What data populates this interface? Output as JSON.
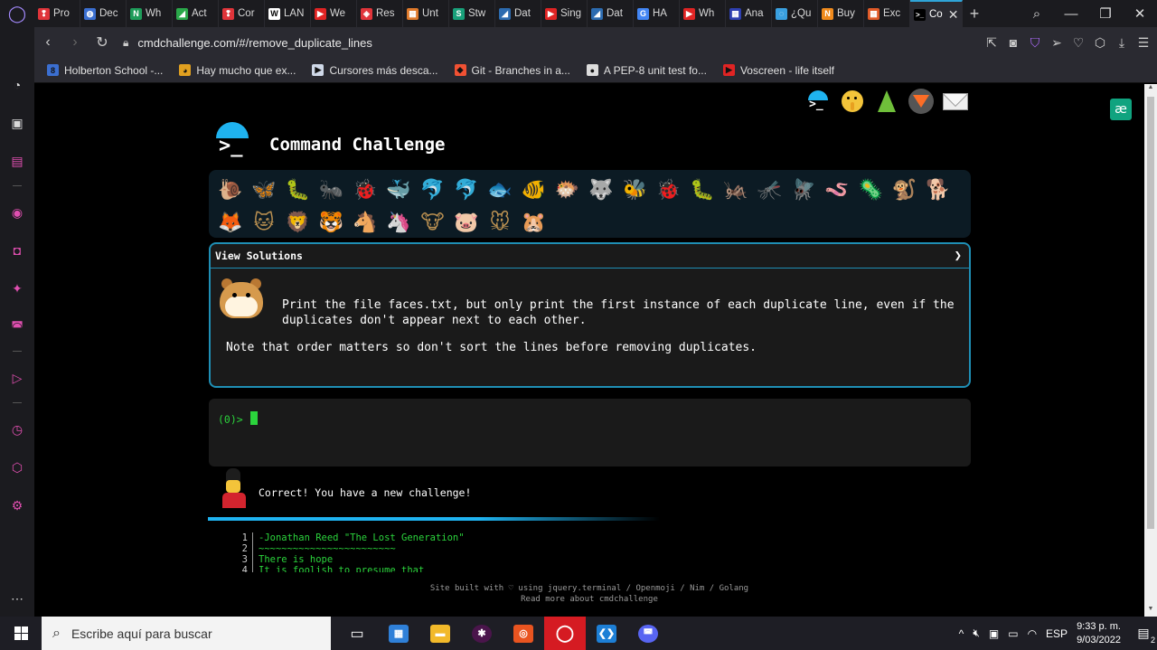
{
  "browser": {
    "tabs": [
      {
        "label": "Pro",
        "color": "#e0343a",
        "glyph": "❢"
      },
      {
        "label": "Dec",
        "color": "#3b6fd1",
        "glyph": "◍"
      },
      {
        "label": "Wh",
        "color": "#1e9c5a",
        "glyph": "N"
      },
      {
        "label": "Act",
        "color": "#2aa84a",
        "glyph": "◢"
      },
      {
        "label": "Cor",
        "color": "#e0343a",
        "glyph": "❢"
      },
      {
        "label": "LAN",
        "color": "#ffffff",
        "glyph": "W"
      },
      {
        "label": "We",
        "color": "#e02424",
        "glyph": "▶"
      },
      {
        "label": "Res",
        "color": "#e0343a",
        "glyph": "◈"
      },
      {
        "label": "Unt",
        "color": "#e07a2b",
        "glyph": "▦"
      },
      {
        "label": "Stw",
        "color": "#18a07a",
        "glyph": "S"
      },
      {
        "label": "Dat",
        "color": "#2c6bb0",
        "glyph": "◢"
      },
      {
        "label": "Sing",
        "color": "#e02424",
        "glyph": "▶"
      },
      {
        "label": "Dat",
        "color": "#2c6bb0",
        "glyph": "◢"
      },
      {
        "label": "HA",
        "color": "#4285f4",
        "glyph": "G"
      },
      {
        "label": "Wh",
        "color": "#e02424",
        "glyph": "▶"
      },
      {
        "label": "Ana",
        "color": "#2e3fb0",
        "glyph": "▦"
      },
      {
        "label": "¿Qu",
        "color": "#3aa0e0",
        "glyph": "◌"
      },
      {
        "label": "Buy",
        "color": "#f08a1c",
        "glyph": "N"
      },
      {
        "label": "Exc",
        "color": "#e05a28",
        "glyph": "▦"
      }
    ],
    "active_tab": {
      "label": "Co",
      "glyph": ">_"
    },
    "url": "cmdchallenge.com/#/remove_duplicate_lines",
    "bookmarks": [
      {
        "label": "Holberton School -...",
        "color": "#3b6fd1",
        "glyph": "8"
      },
      {
        "label": "Hay mucho que ex...",
        "color": "#e0a020",
        "glyph": "◕"
      },
      {
        "label": "Cursores más desca...",
        "color": "#cfd8e8",
        "glyph": "▶"
      },
      {
        "label": "Git - Branches in a...",
        "color": "#f05133",
        "glyph": "◆"
      },
      {
        "label": "A PEP-8 unit test fo...",
        "color": "#dddddd",
        "glyph": "●"
      },
      {
        "label": "Voscreen - life itself",
        "color": "#e02424",
        "glyph": "▶"
      }
    ]
  },
  "page": {
    "site_title": "Command Challenge",
    "logo_prompt": ">_",
    "top_icons": [
      "terminal-icon",
      "shushing-face-icon",
      "evergreen-tree-icon",
      "gitlab-icon",
      "envelope-icon"
    ],
    "ae_badge": "æ",
    "animals_row1": [
      "🐌",
      "🦋",
      "🐛",
      "🐜",
      "🐞",
      "🐳",
      "🐬",
      "🐬",
      "🐟",
      "🐠",
      "🐡",
      "🐺",
      "🐝",
      "🐞",
      "🐛",
      "🦗",
      "🦟",
      "🪰",
      "🪱",
      "🦠",
      "🐒",
      "🐕"
    ],
    "animals_row2": [
      "🦊",
      "🐱",
      "🦁",
      "🐯",
      "🐴",
      "🦄",
      "🐮",
      "🐷",
      "🐭",
      "🐹"
    ],
    "view_solutions": "View Solutions",
    "challenge_text": "Print the file faces.txt, but only print the first instance of each duplicate line, even if the duplicates don't appear next to each other.",
    "challenge_note": "Note that order matters so don't sort the lines before removing duplicates.",
    "terminal_prompt": "(0)>",
    "correct_message": "Correct! You have a new challenge!",
    "file_lines": [
      {
        "n": "1",
        "text": "-Jonathan Reed \"The Lost Generation\""
      },
      {
        "n": "2",
        "text": "~~~~~~~~~~~~~~~~~~~~~~~~"
      },
      {
        "n": "3",
        "text": "There is hope"
      },
      {
        "n": "4",
        "text": "It is foolish to presume that"
      }
    ],
    "footer_line1": "Site built with ♡ using jquery.terminal / Openmoji / Nim / Golang",
    "footer_line2": "Read more about cmdchallenge"
  },
  "taskbar": {
    "search_placeholder": "Escribe aquí para buscar",
    "language": "ESP",
    "time": "9:33 p. m.",
    "date": "9/03/2022",
    "notifications": "2"
  },
  "colors": {
    "accent": "#1fb3f0",
    "terminal_green": "#2bd43c",
    "challenge_border": "#1f8fb5"
  }
}
